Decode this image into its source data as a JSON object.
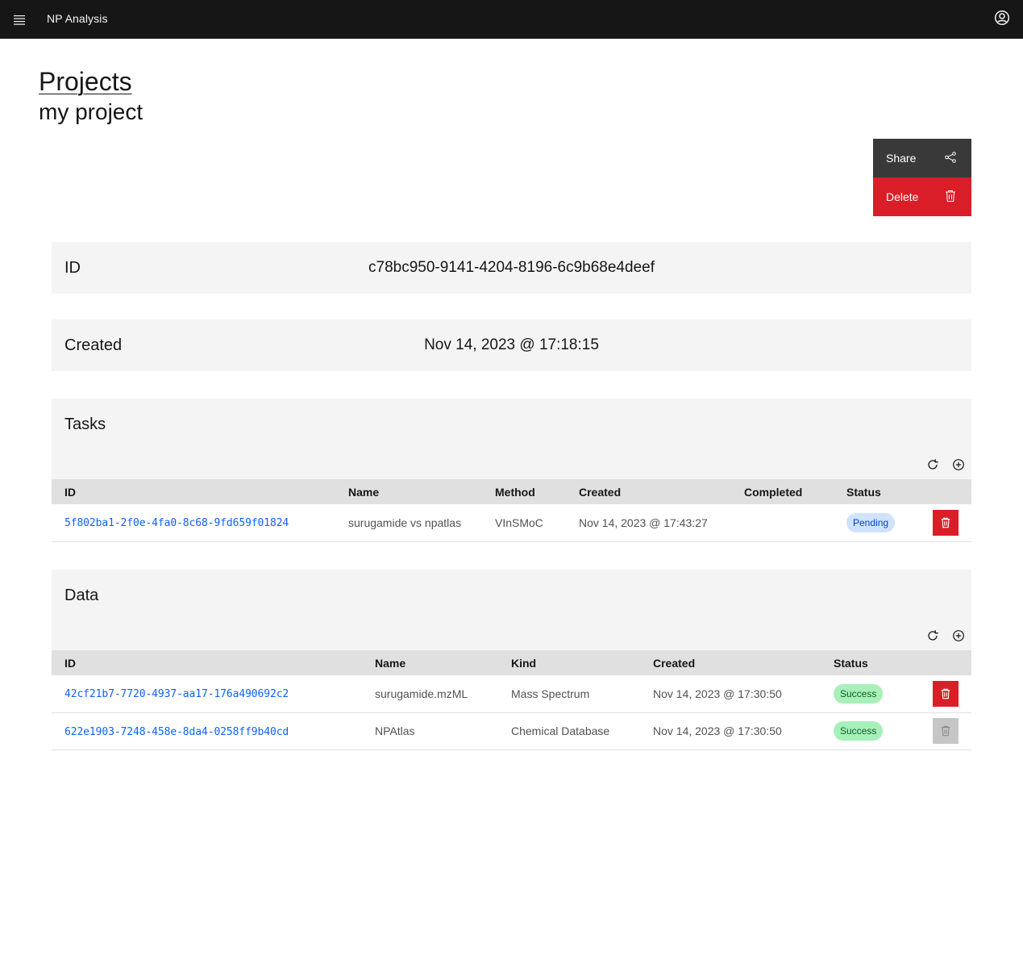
{
  "header": {
    "app_title": "NP Analysis",
    "menu_icon": "hamburger-menu-icon",
    "user_icon": "user-avatar-icon"
  },
  "breadcrumb": {
    "label": "Projects"
  },
  "page": {
    "title": "my project"
  },
  "actions": {
    "share_label": "Share",
    "delete_label": "Delete",
    "share_icon": "share-icon",
    "delete_icon": "trash-icon"
  },
  "info": {
    "id_label": "ID",
    "id_value": "c78bc950-9141-4204-8196-6c9b68e4deef",
    "created_label": "Created",
    "created_value": "Nov 14, 2023 @ 17:18:15"
  },
  "tasks": {
    "title": "Tasks",
    "columns": [
      "ID",
      "Name",
      "Method",
      "Created",
      "Completed",
      "Status"
    ],
    "rows": [
      {
        "id": "5f802ba1-2f0e-4fa0-8c68-9fd659f01824",
        "name": "surugamide vs npatlas",
        "method": "VInSMoC",
        "created": "Nov 14, 2023 @ 17:43:27",
        "completed": "",
        "status": "Pending",
        "deletable": true
      }
    ]
  },
  "data": {
    "title": "Data",
    "columns": [
      "ID",
      "Name",
      "Kind",
      "Created",
      "Status"
    ],
    "rows": [
      {
        "id": "42cf21b7-7720-4937-aa17-176a490692c2",
        "name": "surugamide.mzML",
        "kind": "Mass Spectrum",
        "created": "Nov 14, 2023 @ 17:30:50",
        "status": "Success",
        "deletable": true
      },
      {
        "id": "622e1903-7248-458e-8da4-0258ff9b40cd",
        "name": "NPAtlas",
        "kind": "Chemical Database",
        "created": "Nov 14, 2023 @ 17:30:50",
        "status": "Success",
        "deletable": false
      }
    ]
  },
  "colors": {
    "header_bg": "#161616",
    "danger": "#da1e28",
    "link": "#0f62fe",
    "tag_pending_bg": "#d0e2ff",
    "tag_success_bg": "#a7f0ba"
  }
}
